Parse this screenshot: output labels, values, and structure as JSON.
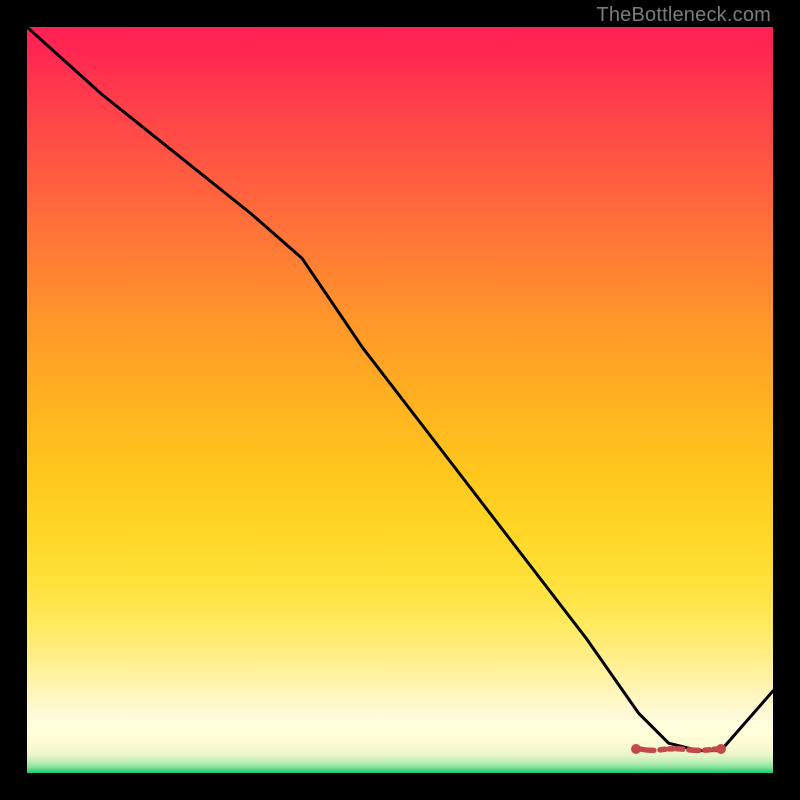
{
  "watermark": "TheBottleneck.com",
  "colors": {
    "frame": "#000000",
    "line": "#000000",
    "marker": "#c24a4a"
  },
  "chart_data": {
    "type": "line",
    "title": "",
    "xlabel": "",
    "ylabel": "",
    "xlim": [
      0,
      100
    ],
    "ylim": [
      0,
      100
    ],
    "grid": false,
    "series": [
      {
        "name": "bottleneck-curve",
        "x": [
          0,
          10,
          20,
          30,
          37,
          45,
          55,
          65,
          75,
          82,
          86,
          90,
          93,
          100
        ],
        "y": [
          100,
          91,
          83,
          75,
          69,
          57,
          44,
          31,
          18,
          8,
          4,
          3,
          3,
          11
        ]
      }
    ],
    "highlight": {
      "name": "optimal-range",
      "x": [
        82,
        93
      ],
      "y": [
        3,
        3
      ]
    },
    "background_gradient_stops": [
      {
        "pos": 0.0,
        "color": "#18ca70"
      },
      {
        "pos": 0.05,
        "color": "#fffed7"
      },
      {
        "pos": 0.5,
        "color": "#ffb81f"
      },
      {
        "pos": 1.0,
        "color": "#ff2054"
      }
    ]
  }
}
